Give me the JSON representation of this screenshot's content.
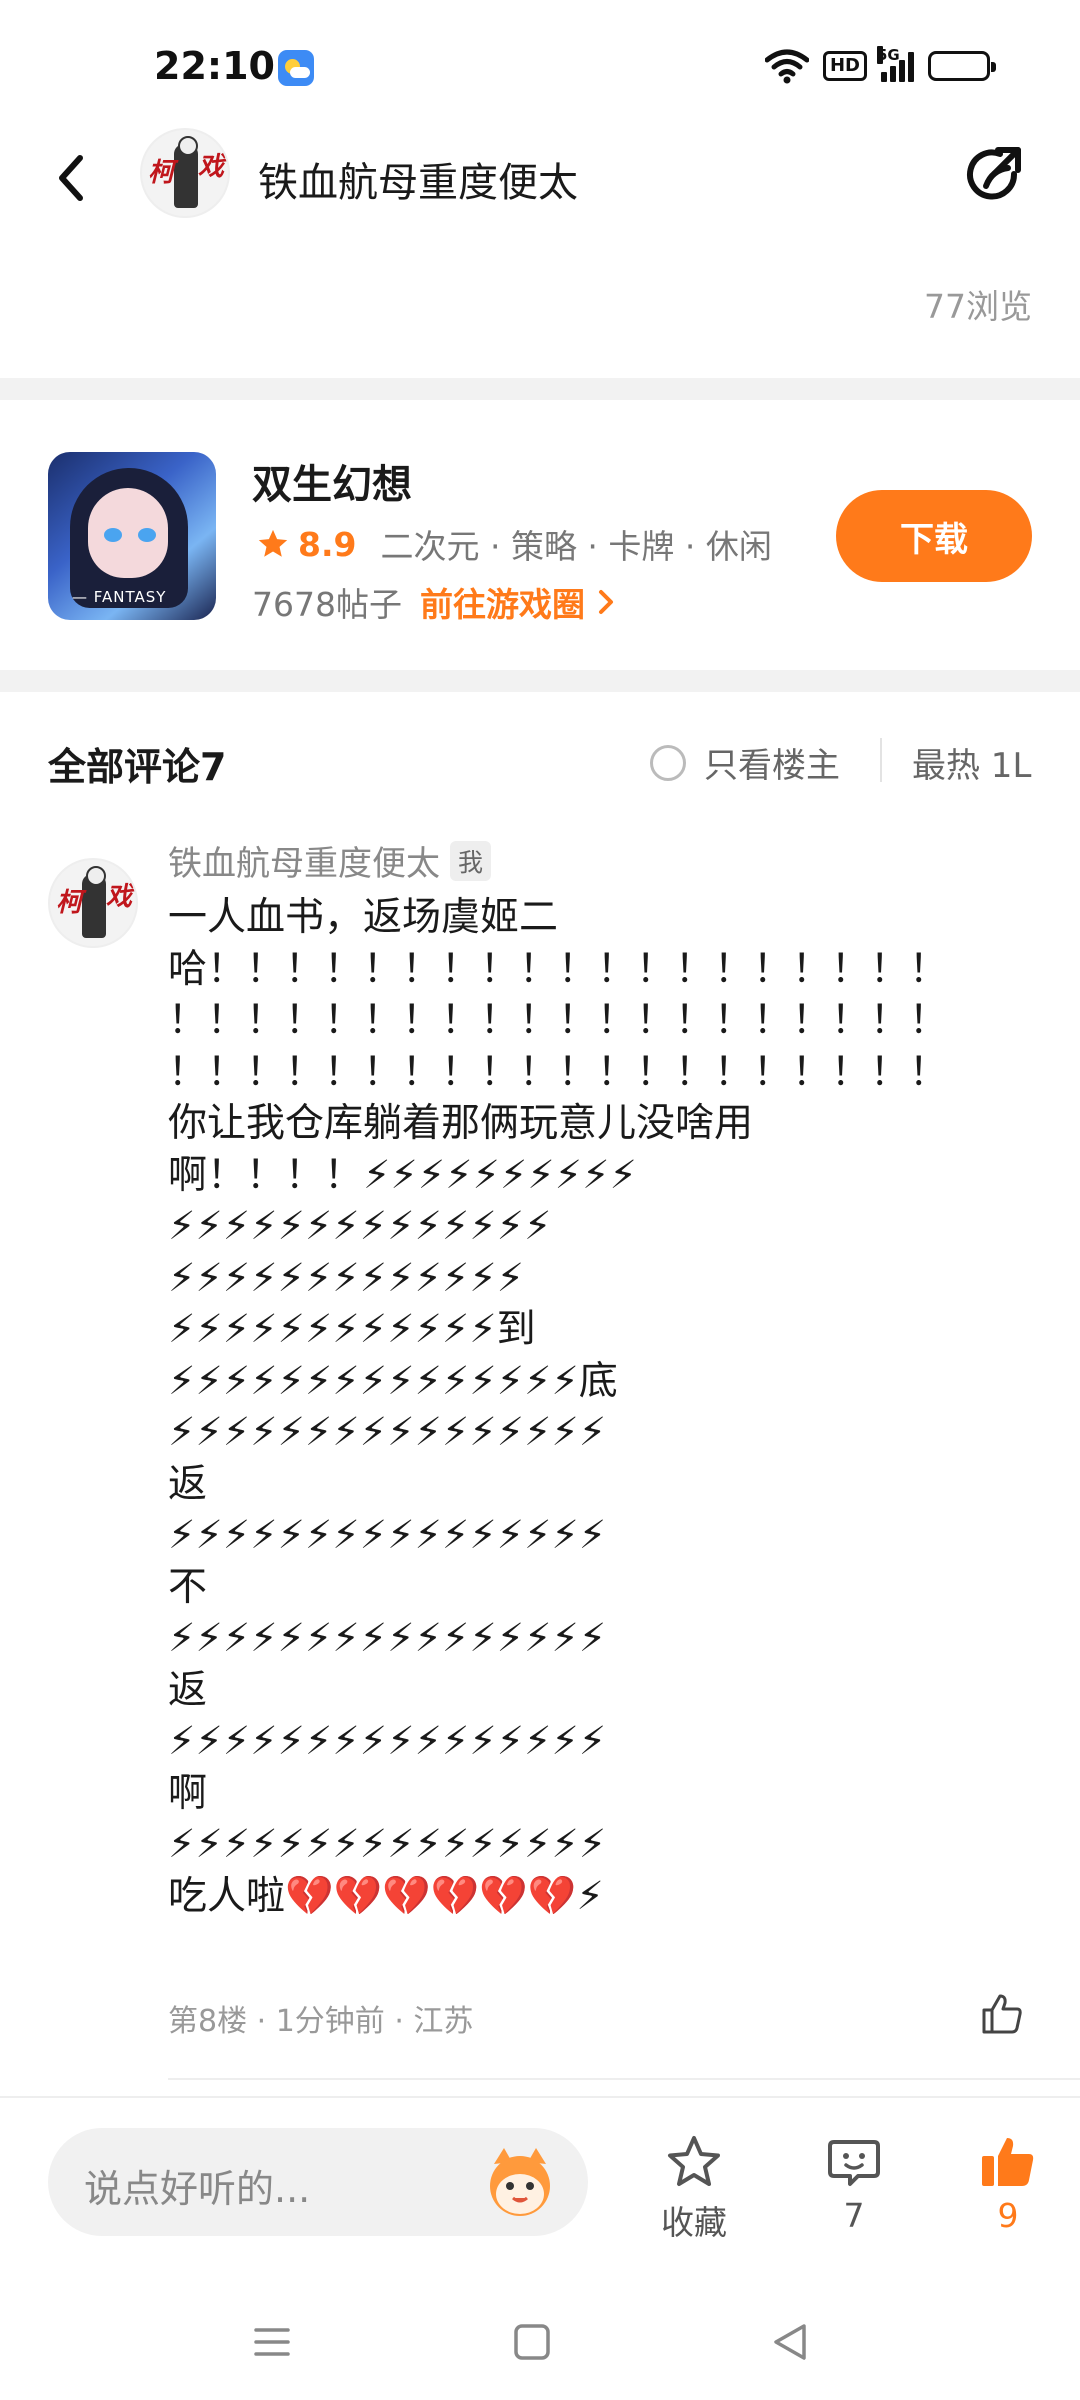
{
  "status_bar": {
    "time": "22:10",
    "network": "5G",
    "hd": "HD"
  },
  "header": {
    "title": "铁血航母重度便太",
    "views": "77浏览"
  },
  "game": {
    "name": "双生幻想",
    "rating": "8.9",
    "tags": "二次元 · 策略 · 卡牌 · 休闲",
    "posts": "7678帖子",
    "goto_label": "前往游戏圈",
    "download_label": "下载",
    "icon_text": "— FANTASY",
    "accent_color": "#ff7a1a"
  },
  "comments": {
    "title": "全部评论7",
    "only_op_label": "只看楼主",
    "sort_label": "最热 1L"
  },
  "comment": {
    "author": "铁血航母重度便太",
    "badge": "我",
    "body": "一人血书，返场虞姬二\n哈！！！！！！！！！！！！！！！！！！！\n！！！！！！！！！！！！！！！！！！！！\n！！！！！！！！！！！！！！！！！！！！\n你让我仓库躺着那俩玩意儿没啥用\n啊！！！！⚡⚡⚡⚡⚡⚡⚡⚡⚡⚡\n⚡⚡⚡⚡⚡⚡⚡⚡⚡⚡⚡⚡⚡⚡\n⚡⚡⚡⚡⚡⚡⚡⚡⚡⚡⚡⚡⚡\n⚡⚡⚡⚡⚡⚡⚡⚡⚡⚡⚡⚡到\n⚡⚡⚡⚡⚡⚡⚡⚡⚡⚡⚡⚡⚡⚡⚡底\n⚡⚡⚡⚡⚡⚡⚡⚡⚡⚡⚡⚡⚡⚡⚡⚡\n返\n⚡⚡⚡⚡⚡⚡⚡⚡⚡⚡⚡⚡⚡⚡⚡⚡\n不\n⚡⚡⚡⚡⚡⚡⚡⚡⚡⚡⚡⚡⚡⚡⚡⚡\n返\n⚡⚡⚡⚡⚡⚡⚡⚡⚡⚡⚡⚡⚡⚡⚡⚡\n啊\n⚡⚡⚡⚡⚡⚡⚡⚡⚡⚡⚡⚡⚡⚡⚡⚡\n吃人啦💔💔💔💔💔💔⚡",
    "meta": "第8楼 · 1分钟前 · 江苏"
  },
  "bottom_bar": {
    "placeholder": "说点好听的...",
    "favorite_label": "收藏",
    "comment_count": "7",
    "like_count": "9"
  }
}
